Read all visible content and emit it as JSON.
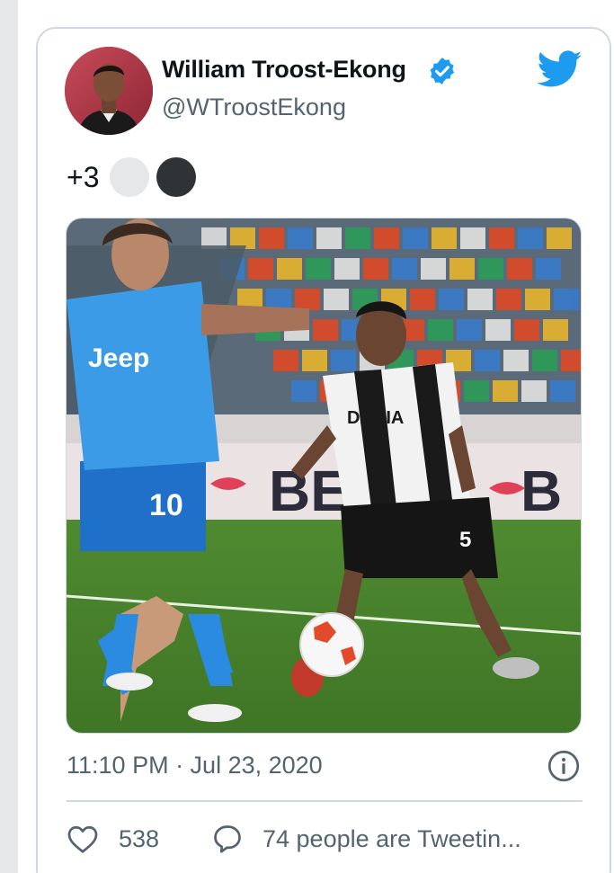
{
  "tweet": {
    "author_name": "William Troost-Ekong",
    "author_handle": "@WTroostEkong",
    "text": "+3",
    "emoji": [
      "white-circle",
      "black-circle"
    ],
    "timestamp": "11:10 PM · Jul 23, 2020",
    "likes": "538",
    "tweeting_text": "74 people are Tweetin...",
    "photo_texts": {
      "jersey_left_sponsor": "Jeep",
      "jersey_left_number": "10",
      "jersey_right_sponsor": "DACIA",
      "jersey_right_number": "5"
    }
  },
  "colors": {
    "brand_blue": "#1d9bf0",
    "text_primary": "#0f1419",
    "text_secondary": "#536471",
    "border": "#cfd9de"
  },
  "icons": {
    "verified": "verified-badge-icon",
    "logo": "twitter-bird-icon",
    "info": "info-icon",
    "like": "heart-icon",
    "reply": "speech-bubble-icon"
  }
}
